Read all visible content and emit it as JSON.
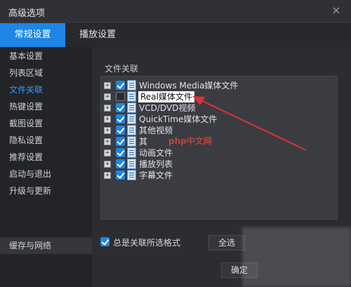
{
  "window": {
    "title": "高级选项",
    "close_glyph": "×"
  },
  "tabs": [
    {
      "label": "常规设置",
      "active": true
    },
    {
      "label": "播放设置",
      "active": false
    }
  ],
  "sidebar": {
    "items": [
      {
        "label": "基本设置"
      },
      {
        "label": "列表区域"
      },
      {
        "label": "文件关联",
        "active": true
      },
      {
        "label": "热键设置"
      },
      {
        "label": "截图设置"
      },
      {
        "label": "隐私设置"
      },
      {
        "label": "推荐设置"
      },
      {
        "label": "启动与退出"
      },
      {
        "label": "升级与更新"
      }
    ],
    "bottom_item": {
      "label": "缓存与网络"
    }
  },
  "file_assoc": {
    "section_label": "文件关联",
    "rows": [
      {
        "label": "Windows Media媒体文件",
        "checked": true
      },
      {
        "label": "Real媒体文件",
        "checked": false,
        "highlighted": true
      },
      {
        "label": "VCD/DVD视频",
        "checked": true
      },
      {
        "label": "QuickTime媒体文件",
        "checked": true
      },
      {
        "label": "其他视频",
        "checked": true
      },
      {
        "label": "其",
        "checked": true
      },
      {
        "label": "动画文件",
        "checked": true
      },
      {
        "label": "播放列表",
        "checked": true
      },
      {
        "label": "字幕文件",
        "checked": true
      }
    ],
    "expander_glyph": "+"
  },
  "watermark": {
    "text": "php中文网"
  },
  "footer": {
    "always_associate_label": "总是关联所选格式",
    "always_associate_checked": true,
    "select_all_label": "全选",
    "ok_label": "确定"
  },
  "colors": {
    "accent": "#1e86e6",
    "active_link": "#2e9bff",
    "arrow": "#e0303a"
  }
}
